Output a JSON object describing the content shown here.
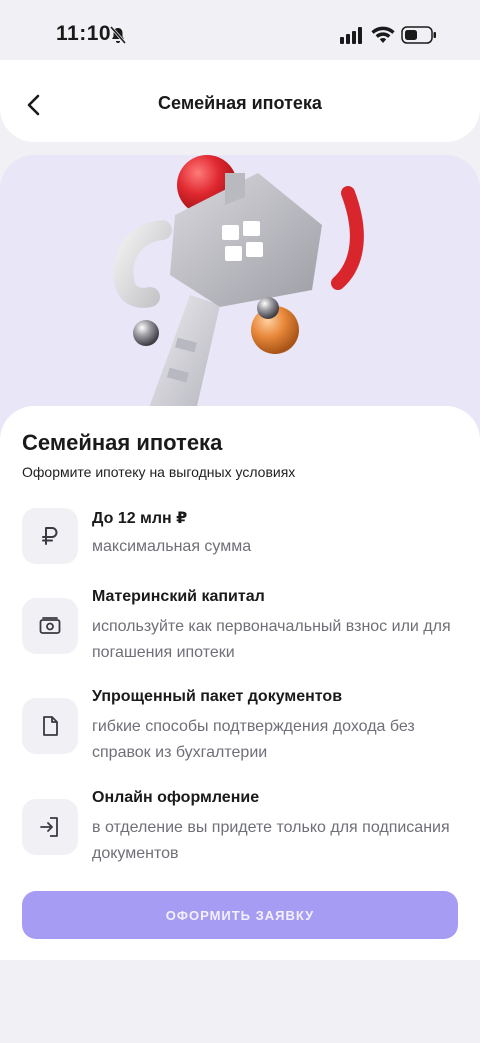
{
  "status_bar": {
    "time": "11:10",
    "icons": [
      "mute-icon",
      "signal-icon",
      "wifi-icon",
      "battery-icon"
    ]
  },
  "header": {
    "title": "Семейная ипотека",
    "back_icon": "chevron-left-icon"
  },
  "hero": {
    "illustration": "house-key-with-spheres",
    "colors": {
      "background": "#e8e6f7",
      "key": "#c9c9cf",
      "red": "#e0282f",
      "orange": "#e8883a"
    }
  },
  "card": {
    "title": "Семейная ипотека",
    "subtitle": "Оформите ипотеку на выгодных условиях",
    "features": [
      {
        "icon": "ruble-icon",
        "title": "До 12 млн ₽",
        "description": "максимальная сумма"
      },
      {
        "icon": "cash-icon",
        "title": "Материнский капитал",
        "description": "используйте как первоначальный взнос или для погашения ипотеки"
      },
      {
        "icon": "document-icon",
        "title": "Упрощенный пакет документов",
        "description": "гибкие способы подтверждения дохода без справок из бухгалтерии"
      },
      {
        "icon": "login-icon",
        "title": "Онлайн оформление",
        "description": "в отделение вы придете только для подписания документов"
      }
    ]
  },
  "submit": {
    "label": "ОФОРМИТЬ ЗАЯВКУ",
    "color": "#a79cf3"
  }
}
